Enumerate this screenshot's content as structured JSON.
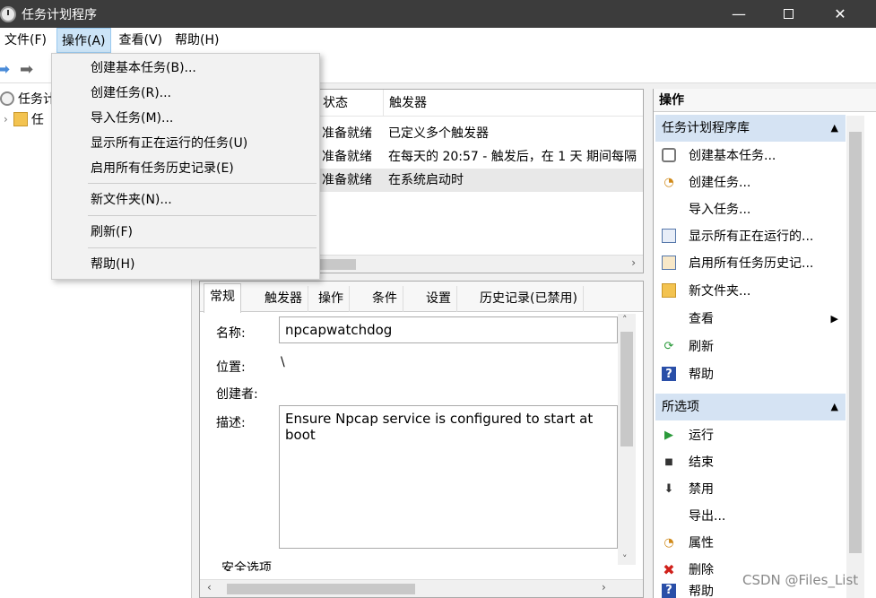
{
  "window": {
    "title": "任务计划程序",
    "min_glyph": "—",
    "close_glyph": "✕"
  },
  "menubar": {
    "file": "文件(F)",
    "action": "操作(A)",
    "view": "查看(V)",
    "help": "帮助(H)"
  },
  "dropdown": {
    "items": [
      "创建基本任务(B)...",
      "创建任务(R)...",
      "导入任务(M)...",
      "显示所有正在运行的任务(U)",
      "启用所有任务历史记录(E)",
      "新文件夹(N)...",
      "刷新(F)",
      "帮助(H)"
    ]
  },
  "tree": {
    "root": "任务计",
    "child": "任"
  },
  "tasklist": {
    "columns": [
      "状态",
      "触发器"
    ],
    "rows": [
      {
        "status": "准备就绪",
        "trigger": "已定义多个触发器"
      },
      {
        "status": "准备就绪",
        "trigger": "在每天的 20:57 - 触发后，在 1 天 期间每隔"
      },
      {
        "status": "准备就绪",
        "trigger": "在系统启动时"
      }
    ]
  },
  "details": {
    "tabs": [
      "常规",
      "触发器",
      "操作",
      "条件",
      "设置",
      "历史记录(已禁用)"
    ],
    "name_label": "名称:",
    "name_value": "npcapwatchdog",
    "location_label": "位置:",
    "location_value": "\\",
    "author_label": "创建者:",
    "description_label": "描述:",
    "description_value": "Ensure Npcap service is configured to start at boot",
    "security_label": "安全选项"
  },
  "actions": {
    "header": "操作",
    "section1": "任务计划程序库",
    "items1": [
      {
        "label": "创建基本任务...",
        "icon": "create-basic-task-icon"
      },
      {
        "label": "创建任务...",
        "icon": "create-task-icon"
      },
      {
        "label": "导入任务...",
        "icon": ""
      },
      {
        "label": "显示所有正在运行的...",
        "icon": "running-tasks-icon"
      },
      {
        "label": "启用所有任务历史记...",
        "icon": "history-icon"
      },
      {
        "label": "新文件夹...",
        "icon": "new-folder-icon"
      },
      {
        "label": "查看",
        "icon": ""
      },
      {
        "label": "刷新",
        "icon": "refresh-icon"
      },
      {
        "label": "帮助",
        "icon": "help-icon"
      }
    ],
    "section2": "所选项",
    "items2": [
      {
        "label": "运行",
        "icon": "run-icon"
      },
      {
        "label": "结束",
        "icon": "stop-icon"
      },
      {
        "label": "禁用",
        "icon": "disable-icon"
      },
      {
        "label": "导出...",
        "icon": ""
      },
      {
        "label": "属性",
        "icon": "properties-icon"
      },
      {
        "label": "删除",
        "icon": "delete-icon"
      },
      {
        "label": "帮助",
        "icon": "help-icon"
      }
    ]
  },
  "watermark": "CSDN @Files_List"
}
